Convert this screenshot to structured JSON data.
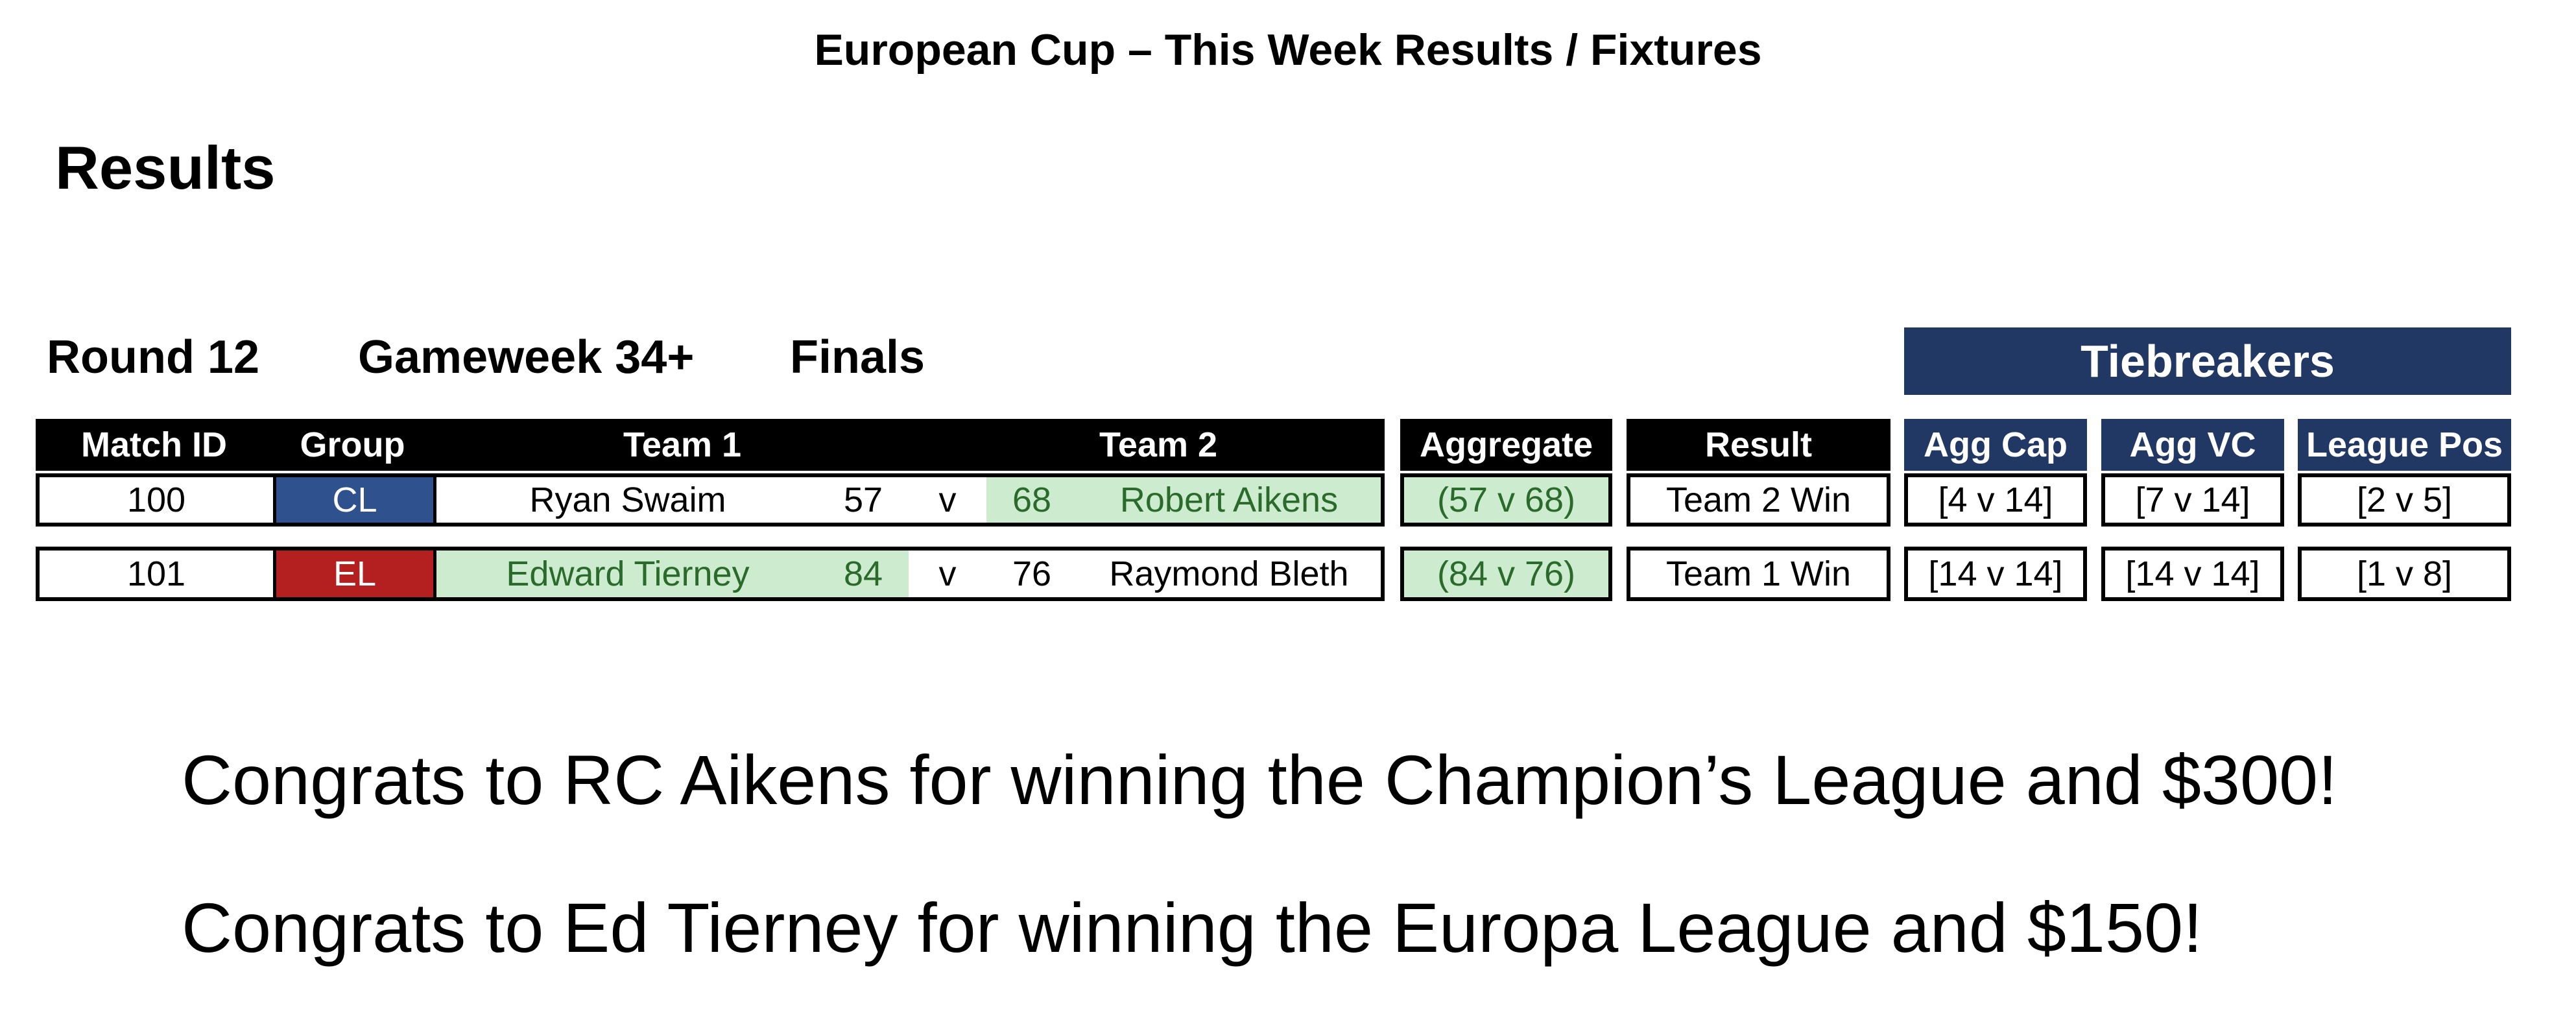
{
  "title": "European Cup – This Week Results / Fixtures",
  "section_heading": "Results",
  "round": {
    "round_label": "Round 12",
    "gameweek_label": "Gameweek 34+",
    "stage_label": "Finals"
  },
  "tiebreakers_label": "Tiebreakers",
  "headers": {
    "match_id": "Match ID",
    "group": "Group",
    "team1": "Team 1",
    "team2": "Team 2",
    "aggregate": "Aggregate",
    "result": "Result",
    "agg_cap": "Agg Cap",
    "agg_vc": "Agg VC",
    "league_pos": "League Pos"
  },
  "matches": [
    {
      "match_id": "100",
      "group": "CL",
      "team1": "Ryan Swaim",
      "score1": "57",
      "vs": "v",
      "score2": "68",
      "team2": "Robert Aikens",
      "aggregate": "(57 v 68)",
      "result": "Team 2 Win",
      "agg_cap": "[4 v 14]",
      "agg_vc": "[7 v 14]",
      "league_pos": "[2 v 5]"
    },
    {
      "match_id": "101",
      "group": "EL",
      "team1": "Edward Tierney",
      "score1": "84",
      "vs": "v",
      "score2": "76",
      "team2": "Raymond Bleth",
      "aggregate": "(84 v 76)",
      "result": "Team 1 Win",
      "agg_cap": "[14 v 14]",
      "agg_vc": "[14 v 14]",
      "league_pos": "[1 v 8]"
    }
  ],
  "colors": {
    "navy": "#213764",
    "cl_blue": "#2f528f",
    "el_red": "#b41f1f",
    "winner_green_bg": "#cdeccf",
    "winner_green_text": "#2a6a2a"
  },
  "congrats": [
    "Congrats to RC Aikens for winning the Champion’s League and $300!",
    "Congrats to Ed Tierney for winning the Europa League and $150!"
  ]
}
